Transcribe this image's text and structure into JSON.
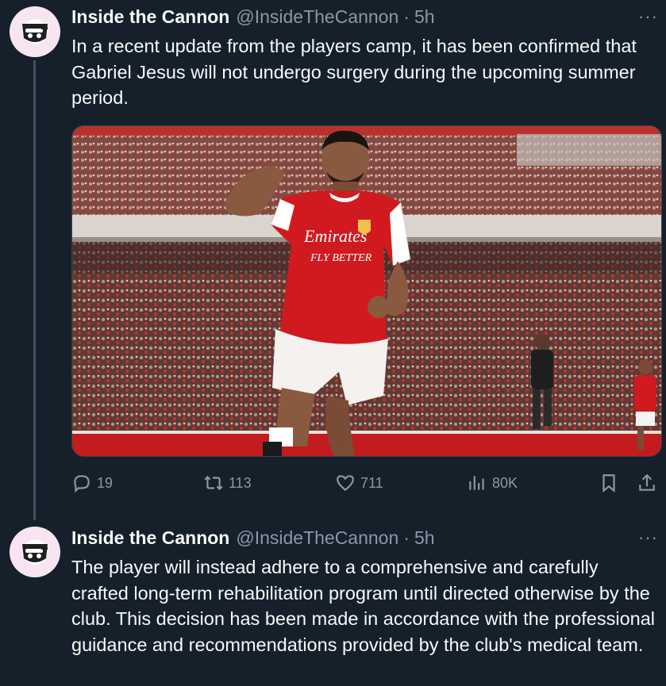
{
  "tweets": [
    {
      "name": "Inside the Cannon",
      "handle": "@InsideTheCannon",
      "separator": "·",
      "time": "5h",
      "more": "···",
      "text": "In a recent update from the players camp, it has been confirmed that Gabriel Jesus will not undergo surgery during the upcoming summer period.",
      "media": {
        "shirt_sponsor_line1": "Emirates",
        "shirt_sponsor_line2": "FLY BETTER"
      },
      "actions": {
        "replies": "19",
        "retweets": "113",
        "likes": "711",
        "views": "80K"
      }
    },
    {
      "name": "Inside the Cannon",
      "handle": "@InsideTheCannon",
      "separator": "·",
      "time": "5h",
      "more": "···",
      "text": "The player will instead adhere to a comprehensive and carefully crafted long-term rehabilitation program until directed otherwise by the club. This decision has been made in accordance with the professional guidance and recommendations provided by the club's medical team."
    }
  ],
  "colors": {
    "background": "#15202b",
    "text": "#f7f9f9",
    "muted": "#8b98a5",
    "arsenal_red": "#db0007"
  }
}
